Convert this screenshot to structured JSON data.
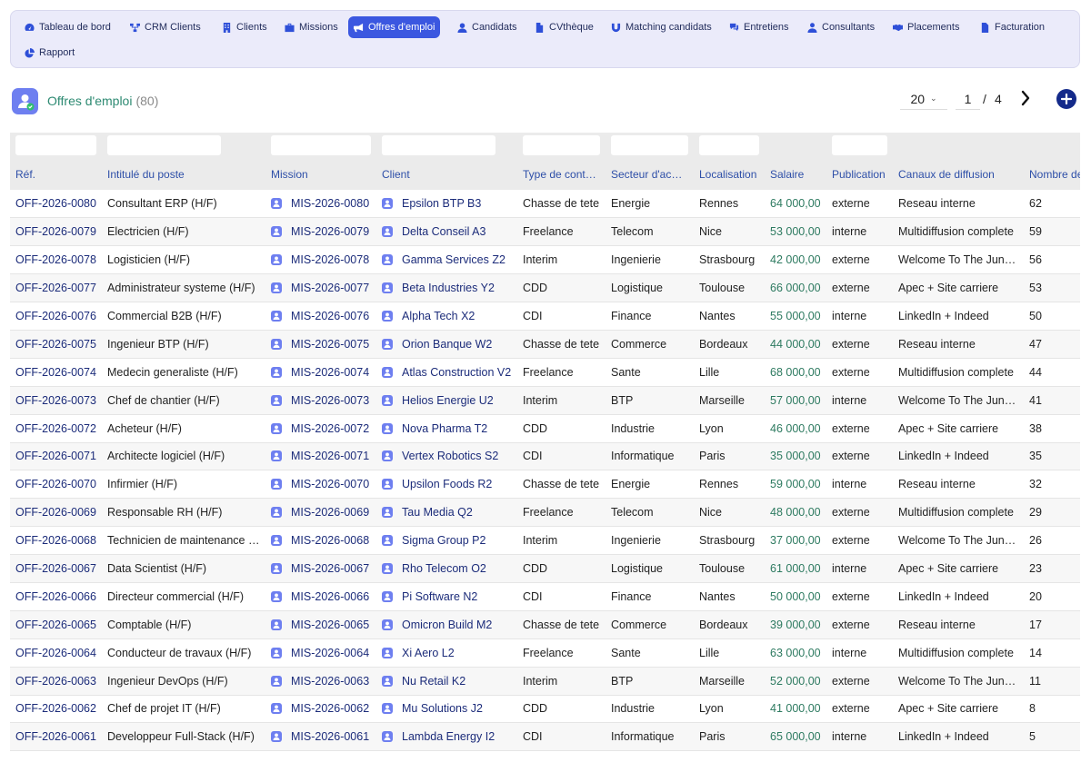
{
  "nav": {
    "items": [
      {
        "label": "Tableau de bord",
        "icon": "dashboard-icon"
      },
      {
        "label": "CRM Clients",
        "icon": "sitemap-icon"
      },
      {
        "label": "Clients",
        "icon": "building-icon"
      },
      {
        "label": "Missions",
        "icon": "briefcase-icon"
      },
      {
        "label": "Offres d'emploi",
        "icon": "bullhorn-icon",
        "active": true
      },
      {
        "label": "Candidats",
        "icon": "user-icon"
      },
      {
        "label": "CVthèque",
        "icon": "file-icon"
      },
      {
        "label": "Matching candidats",
        "icon": "magnet-icon"
      },
      {
        "label": "Entretiens",
        "icon": "comments-icon"
      },
      {
        "label": "Consultants",
        "icon": "user-tie-icon"
      },
      {
        "label": "Placements",
        "icon": "handshake-icon"
      },
      {
        "label": "Facturation",
        "icon": "invoice-icon"
      },
      {
        "label": "Rapport",
        "icon": "chart-pie-icon"
      }
    ]
  },
  "header": {
    "title": "Offres d'emploi",
    "count": "(80)"
  },
  "pager": {
    "page_size": "20",
    "current_page": "1",
    "separator": "/",
    "total_pages": "4"
  },
  "colors": {
    "accent": "#3b57e0",
    "link": "#1c2c7a",
    "salary": "#2d7a60",
    "title": "#2d8a72"
  },
  "table": {
    "columns": [
      "Réf.",
      "Intitulé du poste",
      "Mission",
      "Client",
      "Type de cont…",
      "Secteur d'ac…",
      "Localisation",
      "Salaire",
      "Publication",
      "Canaux de diffusion",
      "Nombre de"
    ],
    "rows": [
      [
        "OFF-2026-0080",
        "Consultant ERP (H/F)",
        "MIS-2026-0080",
        "Epsilon BTP B3",
        "Chasse de tete",
        "Energie",
        "Rennes",
        "64 000,00",
        "externe",
        "Reseau interne",
        "62"
      ],
      [
        "OFF-2026-0079",
        "Electricien (H/F)",
        "MIS-2026-0079",
        "Delta Conseil A3",
        "Freelance",
        "Telecom",
        "Nice",
        "53 000,00",
        "interne",
        "Multidiffusion complete",
        "59"
      ],
      [
        "OFF-2026-0078",
        "Logisticien (H/F)",
        "MIS-2026-0078",
        "Gamma Services Z2",
        "Interim",
        "Ingenierie",
        "Strasbourg",
        "42 000,00",
        "externe",
        "Welcome To The Jungle",
        "56"
      ],
      [
        "OFF-2026-0077",
        "Administrateur systeme (H/F)",
        "MIS-2026-0077",
        "Beta Industries Y2",
        "CDD",
        "Logistique",
        "Toulouse",
        "66 000,00",
        "externe",
        "Apec + Site carriere",
        "53"
      ],
      [
        "OFF-2026-0076",
        "Commercial B2B (H/F)",
        "MIS-2026-0076",
        "Alpha Tech X2",
        "CDI",
        "Finance",
        "Nantes",
        "55 000,00",
        "interne",
        "LinkedIn + Indeed",
        "50"
      ],
      [
        "OFF-2026-0075",
        "Ingenieur BTP (H/F)",
        "MIS-2026-0075",
        "Orion Banque W2",
        "Chasse de tete",
        "Commerce",
        "Bordeaux",
        "44 000,00",
        "externe",
        "Reseau interne",
        "47"
      ],
      [
        "OFF-2026-0074",
        "Medecin generaliste (H/F)",
        "MIS-2026-0074",
        "Atlas Construction V2",
        "Freelance",
        "Sante",
        "Lille",
        "68 000,00",
        "externe",
        "Multidiffusion complete",
        "44"
      ],
      [
        "OFF-2026-0073",
        "Chef de chantier (H/F)",
        "MIS-2026-0073",
        "Helios Energie U2",
        "Interim",
        "BTP",
        "Marseille",
        "57 000,00",
        "interne",
        "Welcome To The Jungle",
        "41"
      ],
      [
        "OFF-2026-0072",
        "Acheteur (H/F)",
        "MIS-2026-0072",
        "Nova Pharma T2",
        "CDD",
        "Industrie",
        "Lyon",
        "46 000,00",
        "externe",
        "Apec + Site carriere",
        "38"
      ],
      [
        "OFF-2026-0071",
        "Architecte logiciel (H/F)",
        "MIS-2026-0071",
        "Vertex Robotics S2",
        "CDI",
        "Informatique",
        "Paris",
        "35 000,00",
        "externe",
        "LinkedIn + Indeed",
        "35"
      ],
      [
        "OFF-2026-0070",
        "Infirmier (H/F)",
        "MIS-2026-0070",
        "Upsilon Foods R2",
        "Chasse de tete",
        "Energie",
        "Rennes",
        "59 000,00",
        "interne",
        "Reseau interne",
        "32"
      ],
      [
        "OFF-2026-0069",
        "Responsable RH (H/F)",
        "MIS-2026-0069",
        "Tau Media Q2",
        "Freelance",
        "Telecom",
        "Nice",
        "48 000,00",
        "externe",
        "Multidiffusion complete",
        "29"
      ],
      [
        "OFF-2026-0068",
        "Technicien de maintenance (H/F)",
        "MIS-2026-0068",
        "Sigma Group P2",
        "Interim",
        "Ingenierie",
        "Strasbourg",
        "37 000,00",
        "externe",
        "Welcome To The Jungle",
        "26"
      ],
      [
        "OFF-2026-0067",
        "Data Scientist (H/F)",
        "MIS-2026-0067",
        "Rho Telecom O2",
        "CDD",
        "Logistique",
        "Toulouse",
        "61 000,00",
        "interne",
        "Apec + Site carriere",
        "23"
      ],
      [
        "OFF-2026-0066",
        "Directeur commercial (H/F)",
        "MIS-2026-0066",
        "Pi Software N2",
        "CDI",
        "Finance",
        "Nantes",
        "50 000,00",
        "externe",
        "LinkedIn + Indeed",
        "20"
      ],
      [
        "OFF-2026-0065",
        "Comptable (H/F)",
        "MIS-2026-0065",
        "Omicron Build M2",
        "Chasse de tete",
        "Commerce",
        "Bordeaux",
        "39 000,00",
        "externe",
        "Reseau interne",
        "17"
      ],
      [
        "OFF-2026-0064",
        "Conducteur de travaux (H/F)",
        "MIS-2026-0064",
        "Xi Aero L2",
        "Freelance",
        "Sante",
        "Lille",
        "63 000,00",
        "interne",
        "Multidiffusion complete",
        "14"
      ],
      [
        "OFF-2026-0063",
        "Ingenieur DevOps (H/F)",
        "MIS-2026-0063",
        "Nu Retail K2",
        "Interim",
        "BTP",
        "Marseille",
        "52 000,00",
        "externe",
        "Welcome To The Jungle",
        "11"
      ],
      [
        "OFF-2026-0062",
        "Chef de projet IT (H/F)",
        "MIS-2026-0062",
        "Mu Solutions J2",
        "CDD",
        "Industrie",
        "Lyon",
        "41 000,00",
        "externe",
        "Apec + Site carriere",
        "8"
      ],
      [
        "OFF-2026-0061",
        "Developpeur Full-Stack (H/F)",
        "MIS-2026-0061",
        "Lambda Energy I2",
        "CDI",
        "Informatique",
        "Paris",
        "65 000,00",
        "interne",
        "LinkedIn + Indeed",
        "5"
      ]
    ]
  }
}
